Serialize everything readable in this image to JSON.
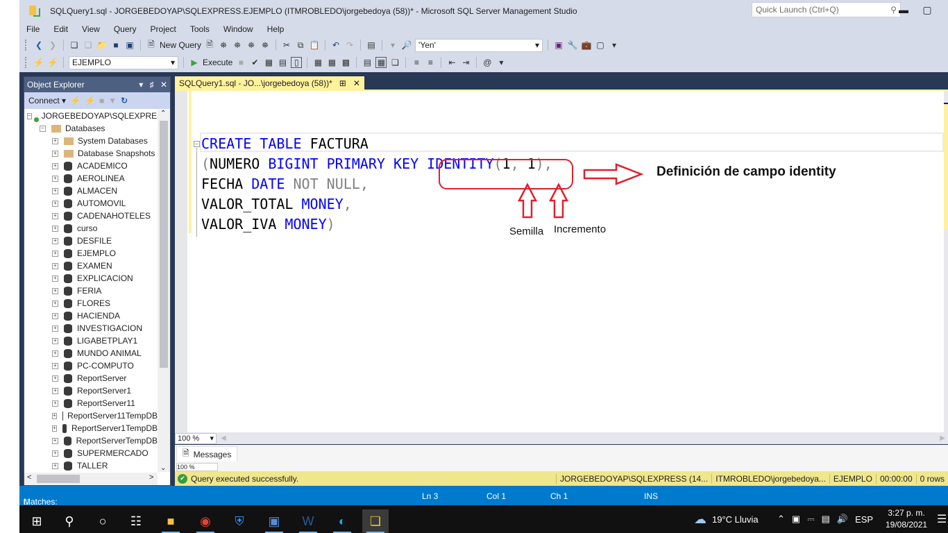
{
  "window": {
    "title": "SQLQuery1.sql - JORGEBEDOYAP\\SQLEXPRESS.EJEMPLO (ITMROBLEDO\\jorgebedoya (58))* - Microsoft SQL Server Management Studio",
    "quick_launch_placeholder": "Quick Launch (Ctrl+Q)"
  },
  "menu": [
    "File",
    "Edit",
    "View",
    "Query",
    "Project",
    "Tools",
    "Window",
    "Help"
  ],
  "toolbar": {
    "new_query_label": "New Query",
    "search_combo_value": "'Yen'",
    "database_combo_value": "EJEMPLO",
    "execute_label": "Execute"
  },
  "object_explorer": {
    "title": "Object Explorer",
    "connect_label": "Connect",
    "server": "JORGEBEDOYAP\\SQLEXPRESS",
    "databases_label": "Databases",
    "folders": [
      "System Databases",
      "Database Snapshots"
    ],
    "databases": [
      "ACADEMICO",
      "AEROLINEA",
      "ALMACEN",
      "AUTOMOVIL",
      "CADENAHOTELES",
      "curso",
      "DESFILE",
      "EJEMPLO",
      "EXAMEN",
      "EXPLICACION",
      "FERIA",
      "FLORES",
      "HACIENDA",
      "INVESTIGACION",
      "LIGABETPLAY1",
      "MUNDO ANIMAL",
      "PC-COMPUTO",
      "ReportServer",
      "ReportServer1",
      "ReportServer11",
      "ReportServer11TempDB",
      "ReportServer1TempDB",
      "ReportServerTempDB",
      "SUPERMERCADO",
      "TALLER"
    ]
  },
  "document": {
    "tab_label": "SQLQuery1.sql - JO...\\jorgebedoya (58))*",
    "code": {
      "l1_kw1": "CREATE",
      "l1_kw2": "TABLE",
      "l1_id": "FACTURA",
      "l2_p1": "(",
      "l2_id": "NUMERO",
      "l2_kw1": "BIGINT",
      "l2_kw2": "PRIMARY",
      "l2_kw3": "KEY",
      "l2_kw4": "IDENTITY",
      "l2_p2": "(",
      "l2_n1": "1",
      "l2_comma": ",",
      "l2_n2": "1",
      "l2_p3": ")",
      "l2_p4": ",",
      "l3_id": "FECHA",
      "l3_kw": "DATE",
      "l3_gr": "NOT NULL,",
      "l4_id": "VALOR_TOTAL",
      "l4_kw": "MONEY",
      "l4_p": ",",
      "l5_id": "VALOR_IVA",
      "l5_kw": "MONEY",
      "l5_p": ")"
    },
    "annotations": {
      "title": "Definición de campo identity",
      "seed": "Semilla",
      "increment": "Incremento"
    },
    "zoom": "100 %",
    "messages_tab": "Messages",
    "query_status": "Query executed successfully.",
    "status_cells": [
      "JORGEBEDOYAP\\SQLEXPRESS (14...",
      "ITMROBLEDO\\jorgebedoya...",
      "EJEMPLO",
      "00:00:00",
      "0 rows"
    ]
  },
  "statusbar": {
    "matches": "Matches: (",
    "ln": "Ln 3",
    "col": "Col 1",
    "ch": "Ch 1",
    "mode": "INS"
  },
  "taskbar": {
    "weather": "19°C  Lluvia",
    "lang": "ESP",
    "time": "3:27 p. m.",
    "date": "19/08/2021"
  },
  "colors": {
    "keyword": "#0000ff",
    "gray": "#808080",
    "annotation_red": "#e0202a",
    "status_blue": "#007acc",
    "tab_yellow": "#fff29d"
  }
}
